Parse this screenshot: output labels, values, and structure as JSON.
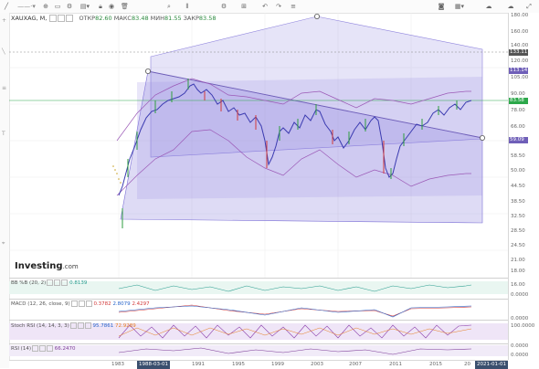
{
  "toolbar": {
    "timeframe": "M",
    "items": [
      "line-tool",
      "crosshair-tool",
      "color-tool",
      "settings-tool",
      "fill-tool",
      "lock-tool",
      "eye-tool",
      "trash-tool"
    ]
  },
  "legend": {
    "symbol": "XAUXAG, M,",
    "open_label": "ОТКР",
    "open": "82.60",
    "high_label": "МАКС",
    "high": "83.48",
    "low_label": "МИН",
    "low": "81.55",
    "close_label": "ЗАКР",
    "close": "83.58"
  },
  "price_axis": {
    "ticks": [
      "180.00",
      "160.00",
      "140.00",
      "120.00",
      "105.00",
      "90.00",
      "78.00",
      "66.00",
      "58.50",
      "50.00",
      "44.50",
      "38.50",
      "32.50",
      "28.50",
      "24.50",
      "21.00",
      "18.00",
      "16.00"
    ],
    "tag_top": "133.11",
    "tag_mid": "113.14",
    "tag_last": "83.58",
    "tag_low": "59.09"
  },
  "logo": {
    "brand": "Investing",
    "suffix": ".com"
  },
  "indicators": {
    "bb": {
      "label": "BB %B (20, 2)",
      "value": "0.8139",
      "axis": "0.0000"
    },
    "macd": {
      "label": "MACD (12, 26, close, 9)",
      "v1": "0.3782",
      "v2": "2.8079",
      "v3": "2.4297",
      "axis": "0.0000"
    },
    "stoch": {
      "label": "Stoch RSI (14, 14, 3, 3)",
      "v1": "95.7861",
      "v2": "72.9289",
      "axis_top": "100.0000",
      "axis_bottom": "0.0000"
    },
    "rsi": {
      "label": "RSI (14)",
      "value": "66.2470",
      "axis": "0.0000"
    }
  },
  "x_axis": {
    "ticks": [
      "1983",
      "1991",
      "1995",
      "1999",
      "2003",
      "2007",
      "2011",
      "2015",
      "20"
    ],
    "selected_left": "1988-03-01",
    "selected_right": "2021-01-01"
  },
  "colors": {
    "channel_fill": "#7b6fd6",
    "bull_candle": "#2e9e3e",
    "bear_candle": "#d23a3a",
    "last_price": "#2ca84a",
    "tag_purple": "#6f5fb8"
  },
  "chart_data": {
    "type": "line",
    "title": "",
    "xlabel": "",
    "ylabel": "",
    "x": [
      1983,
      1985,
      1987,
      1989,
      1991,
      1993,
      1995,
      1997,
      1999,
      2001,
      2003,
      2005,
      2007,
      2009,
      2011,
      2013,
      2015,
      2017,
      2019,
      2021
    ],
    "series": [
      {
        "values": [
          20,
          38,
          55,
          68,
          88,
          80,
          72,
          68,
          60,
          68,
          70,
          62,
          52,
          58,
          35,
          55,
          72,
          78,
          85,
          83.58
        ]
      }
    ],
    "ylim": [
      16,
      180
    ],
    "scale": "log"
  }
}
